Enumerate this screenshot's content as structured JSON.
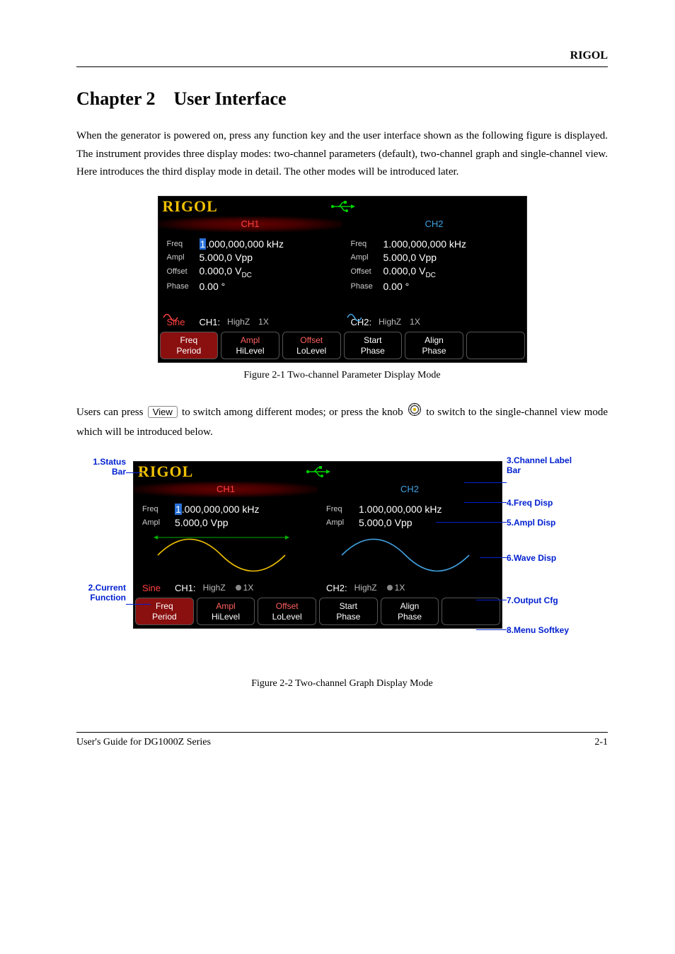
{
  "header_right": "RIGOL",
  "chapter_title": "Chapter 2 User Interface",
  "intro_para": "When the generator is powered on, press any function key and the user interface shown as the following figure is displayed. The instrument provides three display modes: two-channel parameters (default), two-channel graph and single-channel view. Here introduces the third display mode in detail. The other modes will be introduced later.",
  "device": {
    "logo": "RIGOL",
    "ch1_label": "CH1",
    "ch2_label": "CH2",
    "ch1": {
      "freq_name": "Freq",
      "freq_cursor": "1",
      "freq_rest": ".000,000,000 kHz",
      "ampl_name": "Ampl",
      "ampl_val": "5.000,0 Vpp",
      "offset_name": "Offset",
      "offset_val": "0.000,0 V",
      "offset_sub": "DC",
      "phase_name": "Phase",
      "phase_val": "0.00 °"
    },
    "ch2": {
      "freq_name": "Freq",
      "freq_val": "1.000,000,000 kHz",
      "ampl_name": "Ampl",
      "ampl_val": "5.000,0 Vpp",
      "offset_name": "Offset",
      "offset_val": "0.000,0 V",
      "offset_sub": "DC",
      "phase_name": "Phase",
      "phase_val": "0.00 °"
    },
    "outcfg": {
      "func": "Sine",
      "ch1_tag": "CH1:",
      "ch2_tag": "CH2:",
      "imp": "HighZ",
      "atten": "1X"
    },
    "softkeys": [
      {
        "l1": "Freq",
        "l2": "Period",
        "selected": true
      },
      {
        "l1": "Ampl",
        "l2": "HiLevel",
        "l1sel": true
      },
      {
        "l1": "Offset",
        "l2": "LoLevel",
        "l1sel": true
      },
      {
        "l1": "Start",
        "l2": "Phase"
      },
      {
        "l1": "Align",
        "l2": "Phase"
      },
      {
        "l1": "",
        "l2": ""
      }
    ]
  },
  "fig1_caption": "Figure 2-1 Two-channel Parameter Display Mode",
  "para2_a": "Users can press ",
  "para2_key": "View",
  "para2_b": " to switch among different modes; or press the knob ",
  "para2_c": " to switch to the single-channel view mode which will be introduced below.",
  "callouts": {
    "c1": "1.Status\nBar",
    "c2": "2.Current\nFunction",
    "c3": "3.Channel Label\nBar",
    "c4": "4.Freq Disp",
    "c5": "5.Ampl Disp",
    "c6": "6.Wave Disp",
    "c7": "7.Output Cfg",
    "c8": "8.Menu Softkey"
  },
  "fig2_caption": "Figure 2-2 Two-channel Graph Display Mode",
  "footer_left": "User's Guide for DG1000Z Series",
  "footer_right": "2-1"
}
